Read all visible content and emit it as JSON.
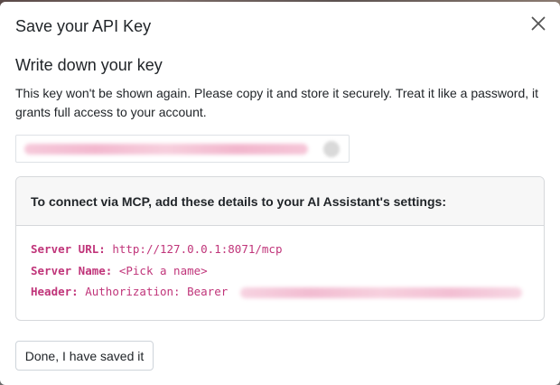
{
  "modal": {
    "title": "Save your API Key",
    "close_icon": "close-icon",
    "heading": "Write down your key",
    "description": "This key won't be shown again. Please copy it and store it securely. Treat it like a password, it grants full access to your account.",
    "key_field": {
      "copy_icon": "copy-icon"
    },
    "mcp": {
      "header": "To connect via MCP, add these details to your AI Assistant's settings:",
      "server_url_label": "Server URL:",
      "server_url_value": "http://127.0.0.1:8071/mcp",
      "server_name_label": "Server Name:",
      "server_name_value": "<Pick a name>",
      "header_label": "Header:",
      "header_value": "Authorization: Bearer"
    },
    "done_button": "Done, I have saved it"
  },
  "colors": {
    "code_text": "#c0357a",
    "card_header_bg": "#f7f7f7",
    "border": "#d6d8db"
  }
}
